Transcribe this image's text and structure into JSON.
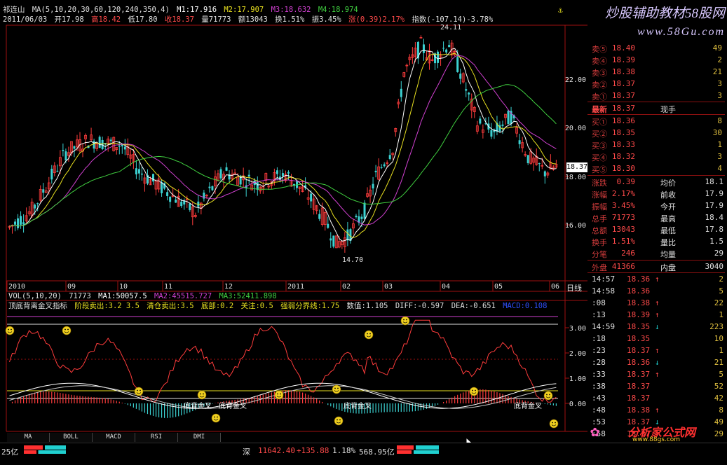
{
  "header": {
    "stock_name": "祁连山",
    "ma_label": "MA(5,10,20,30,60,120,240,350,4)",
    "m1": "M1:17.916",
    "m2": "M2:17.907",
    "m3": "M3:18.632",
    "m4": "M4:18.974",
    "date": "2011/06/03",
    "open": "开17.98",
    "high": "高18.42",
    "low": "低17.80",
    "close": "收18.37",
    "volume": "量71773",
    "amount": "额13043",
    "turnover": "换1.51%",
    "amplitude": "振3.45%",
    "change": "涨(0.39)2.17%",
    "index": "指数(-107.14)-3.78%"
  },
  "watermark": {
    "top_text": "炒股辅助教材58股网",
    "top_url": "www.58Gu.com",
    "bottom_text": "分析家公式网",
    "bottom_url": "www.88gs.com"
  },
  "price_chart": {
    "price_axis": [
      "22.00",
      "20.00",
      "18.00",
      "16.00"
    ],
    "current_price_tag": "18.37",
    "high_label": "24.11",
    "low_label": "14.70",
    "time_axis": [
      "2010",
      "09",
      "10",
      "11",
      "12",
      "2011",
      "02",
      "03",
      "04",
      "05",
      "06"
    ],
    "period_label": "日线"
  },
  "vol_header": {
    "label": "VOL(5,10,20)",
    "vol": "71773",
    "ma1": "MA1:50057.5",
    "ma2": "MA2:45515.727",
    "ma3": "MA3:52411.898"
  },
  "indicator": {
    "name": "顶底背离金叉指标",
    "sell1": "阶段卖出:3.2 3.5",
    "sell2": "清仓卖出:3.5",
    "bottom": "底部:0.2",
    "watch": "关注:0.5",
    "strong": "强弱分界线:1.75",
    "value": "数值:1.105",
    "diff": "DIFF:-0.597",
    "dea": "DEA:-0.651",
    "macd": "MACD:0.108",
    "axis": [
      "3.00",
      "2.00",
      "1.00",
      "0.00"
    ],
    "annot1": "底背金叉",
    "annot2": "底背金叉",
    "annot3": "底背金叉",
    "annot4": "底背金叉"
  },
  "tabs": [
    "MA",
    "BOLL",
    "MACD",
    "RSI",
    "DMI"
  ],
  "quote": {
    "asks": [
      {
        "label": "卖⑤",
        "price": "18.40",
        "vol": "49"
      },
      {
        "label": "卖④",
        "price": "18.39",
        "vol": "2"
      },
      {
        "label": "卖③",
        "price": "18.38",
        "vol": "21"
      },
      {
        "label": "卖②",
        "price": "18.37",
        "vol": "3"
      },
      {
        "label": "卖①",
        "price": "18.37",
        "vol": "3"
      }
    ],
    "latest_label": "最新",
    "latest_price": "18.37",
    "latest_extra": "现手",
    "bids": [
      {
        "label": "买①",
        "price": "18.36",
        "vol": "8"
      },
      {
        "label": "买②",
        "price": "18.35",
        "vol": "30"
      },
      {
        "label": "买③",
        "price": "18.33",
        "vol": "1"
      },
      {
        "label": "买④",
        "price": "18.32",
        "vol": "3"
      },
      {
        "label": "买⑤",
        "price": "18.30",
        "vol": "4"
      }
    ],
    "stats": [
      {
        "l1": "涨跌",
        "v1": "0.39",
        "l2": "均价",
        "v2": "18.1"
      },
      {
        "l1": "涨幅",
        "v1": "2.17%",
        "l2": "前收",
        "v2": "17.9"
      },
      {
        "l1": "振幅",
        "v1": "3.45%",
        "l2": "今开",
        "v2": "17.9"
      },
      {
        "l1": "总手",
        "v1": "71773",
        "l2": "最高",
        "v2": "18.4"
      },
      {
        "l1": "总额",
        "v1": "13043",
        "l2": "最低",
        "v2": "17.8"
      },
      {
        "l1": "换手",
        "v1": "1.51%",
        "l2": "量比",
        "v2": "1.5"
      },
      {
        "l1": "分笔",
        "v1": "246",
        "l2": "均量",
        "v2": "29"
      }
    ],
    "outer_label": "外盘",
    "outer_val": "41366",
    "inner_label": "内盘",
    "inner_val": "3040",
    "ticks": [
      {
        "t": "14:57",
        "p": "18.36",
        "a": "↑",
        "v": "2"
      },
      {
        "t": "14:58",
        "p": "18.36",
        "a": "",
        "v": "5"
      },
      {
        "t": ":08",
        "p": "18.38",
        "a": "↑",
        "v": "22"
      },
      {
        "t": ":13",
        "p": "18.39",
        "a": "↑",
        "v": "1"
      },
      {
        "t": "14:59",
        "p": "18.35",
        "a": "↓",
        "v": "223"
      },
      {
        "t": ":18",
        "p": "18.35",
        "a": "",
        "v": "10"
      },
      {
        "t": ":23",
        "p": "18.37",
        "a": "↑",
        "v": "1"
      },
      {
        "t": ":28",
        "p": "18.36",
        "a": "↓",
        "v": "21"
      },
      {
        "t": ":33",
        "p": "18.37",
        "a": "↑",
        "v": "5"
      },
      {
        "t": ":38",
        "p": "18.37",
        "a": "",
        "v": "52"
      },
      {
        "t": ":43",
        "p": "18.37",
        "a": "",
        "v": "42"
      },
      {
        "t": ":48",
        "p": "18.38",
        "a": "↑",
        "v": "8"
      },
      {
        "t": ":53",
        "p": "18.37",
        "a": "↓",
        "v": "49"
      },
      {
        "t": ":58",
        "p": "18.37",
        "a": "",
        "v": "29"
      }
    ]
  },
  "status": {
    "left_amount": "25亿",
    "market": "深",
    "index_val": "11642.40",
    "index_chg": "+135.88",
    "index_pct": "1.18%",
    "index_amt": "568.95亿"
  },
  "colors": {
    "up": "#ff3c3c",
    "down": "#3cd2d2",
    "ma_white": "#ffffff",
    "ma_yellow": "#e8e020",
    "ma_magenta": "#d040d0",
    "ma_green": "#40d040",
    "frame": "#a01010"
  }
}
